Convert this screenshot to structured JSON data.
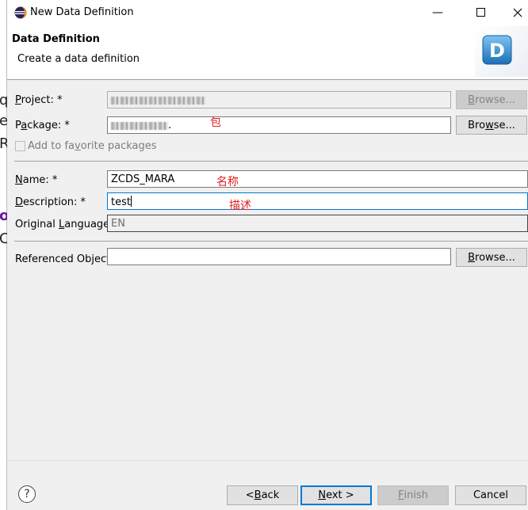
{
  "window": {
    "title": "New Data Definition",
    "minimize_glyph": "—",
    "maximize_glyph": "☐",
    "close_glyph": "✕"
  },
  "header": {
    "title": "Data Definition",
    "subtitle": "Create a data definition",
    "banner_icon": "D"
  },
  "background_bleed": [
    "q",
    "e",
    "R",
    "o",
    "C"
  ],
  "form": {
    "project": {
      "label_pre": "",
      "label_u": "P",
      "label_post": "roject: *",
      "browse": {
        "label_pre": "",
        "label_u": "B",
        "label_post": "rowse..."
      }
    },
    "package": {
      "label_pre": "P",
      "label_u": "a",
      "label_post": "ckage: *",
      "value_tail": ".",
      "browse": {
        "label_pre": "Bro",
        "label_u": "w",
        "label_post": "se..."
      }
    },
    "favorite": {
      "label_pre": "Add to fa",
      "label_u": "v",
      "label_post": "orite packages"
    },
    "name": {
      "label_pre": "",
      "label_u": "N",
      "label_post": "ame: *",
      "value": "ZCDS_MARA"
    },
    "description": {
      "label_pre": "",
      "label_u": "D",
      "label_post": "escription: *",
      "value": "test"
    },
    "original_language": {
      "label_pre": "Original ",
      "label_u": "L",
      "label_post": "anguage:",
      "value": "EN"
    },
    "referenced_object": {
      "label": "Referenced Object:",
      "value": "",
      "browse": {
        "label_pre": "",
        "label_u": "B",
        "label_post": "rowse..."
      }
    }
  },
  "annotations": {
    "package": "包",
    "name": "名称",
    "description": "描述"
  },
  "footer": {
    "help_glyph": "?",
    "back": {
      "pre": "< ",
      "u": "B",
      "post": "ack"
    },
    "next": {
      "pre": "",
      "u": "N",
      "post": "ext >"
    },
    "finish": {
      "pre": "",
      "u": "F",
      "post": "inish"
    },
    "cancel": "Cancel"
  }
}
